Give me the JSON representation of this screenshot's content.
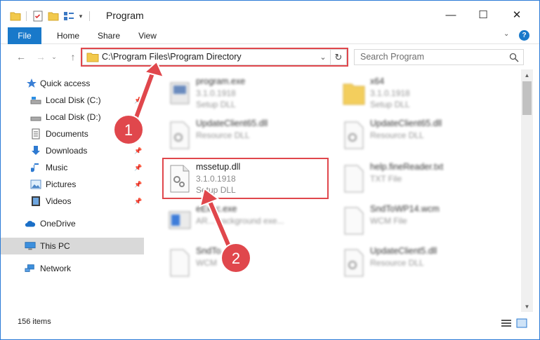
{
  "window": {
    "title": "Program",
    "controls": {
      "minimize": "—",
      "maximize": "☐",
      "close": "✕"
    }
  },
  "ribbon": {
    "tabs": [
      "File",
      "Home",
      "Share",
      "View"
    ]
  },
  "address": {
    "path": "C:\\Program Files\\Program Directory"
  },
  "search": {
    "placeholder": "Search Program"
  },
  "sidebar": {
    "items": [
      {
        "label": "Quick access",
        "icon": "star-icon"
      },
      {
        "label": "Local Disk (C:)",
        "icon": "drive-icon"
      },
      {
        "label": "Local Disk (D:)",
        "icon": "drive-icon"
      },
      {
        "label": "Documents",
        "icon": "documents-icon"
      },
      {
        "label": "Downloads",
        "icon": "download-icon"
      },
      {
        "label": "Music",
        "icon": "music-icon"
      },
      {
        "label": "Pictures",
        "icon": "pictures-icon"
      },
      {
        "label": "Videos",
        "icon": "videos-icon"
      },
      {
        "label": "OneDrive",
        "icon": "cloud-icon"
      },
      {
        "label": "This PC",
        "icon": "computer-icon"
      },
      {
        "label": "Network",
        "icon": "network-icon"
      }
    ]
  },
  "files": [
    {
      "name": "program.exe",
      "version": "3.1.0.1918",
      "type": "Setup DLL"
    },
    {
      "name": "x64",
      "version": "3.1.0.1918",
      "type": "Setup DLL"
    },
    {
      "name": "UpdateClient65.dll",
      "type": "Resource DLL"
    },
    {
      "name": "UpdateClient65.dll",
      "type": "Resource DLL"
    },
    {
      "name": "mssetup.dll",
      "version": "3.1.0.1918",
      "type": "Setup DLL"
    },
    {
      "name": "help.fineReader.txt",
      "type": "TXT File"
    },
    {
      "name": "eExec.exe",
      "type": "AR... background exe..."
    },
    {
      "name": "SndToWP14.wcm",
      "type": "WCM File"
    },
    {
      "name": "SndTo...wcm",
      "type": "WCM"
    },
    {
      "name": "UpdateClient5.dll",
      "type": "Resource DLL"
    }
  ],
  "annotations": {
    "step1": "1",
    "step2": "2"
  },
  "status": {
    "item_count": "156 items"
  },
  "colors": {
    "accent": "#1979ca",
    "annotation_red": "#e0474c"
  }
}
